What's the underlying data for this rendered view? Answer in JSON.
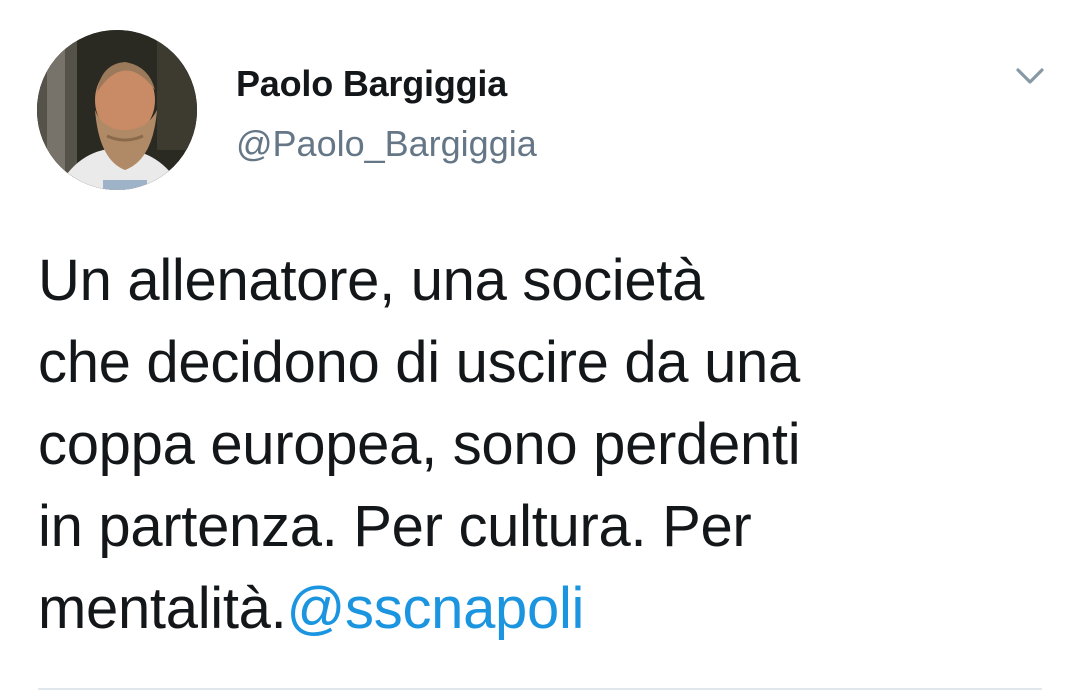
{
  "author": {
    "display_name": "Paolo Bargiggia",
    "handle": "@Paolo_Bargiggia"
  },
  "tweet": {
    "lines": [
      "Un allenatore, una società",
      "che decidono di uscire da una",
      "coppa europea, sono perdenti",
      "in partenza. Per cultura. Per"
    ],
    "last_line_text": "mentalità.",
    "mention": "@sscnapoli"
  },
  "icons": {
    "menu": "chevron-down-icon"
  },
  "colors": {
    "text": "#14171a",
    "secondary": "#657786",
    "link": "#1b95e0",
    "divider": "#e1e8ed"
  }
}
